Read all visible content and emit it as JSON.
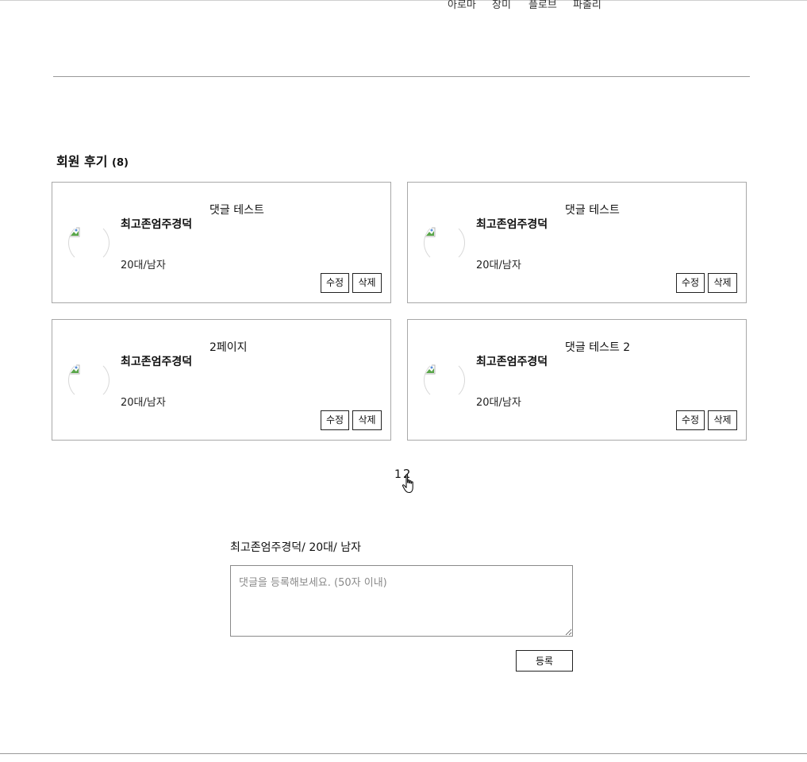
{
  "top_nav": {
    "items": [
      "아로마",
      "장미",
      "플로브",
      "파출리"
    ]
  },
  "reviews": {
    "title": "회원 후기",
    "count": "(8)",
    "cards": [
      {
        "comment": "댓글 테스트",
        "name": "최고존엄주경덕",
        "meta": "20대/남자",
        "edit_label": "수정",
        "delete_label": "삭제"
      },
      {
        "comment": "댓글 테스트",
        "name": "최고존엄주경덕",
        "meta": "20대/남자",
        "edit_label": "수정",
        "delete_label": "삭제"
      },
      {
        "comment": "2페이지",
        "name": "최고존엄주경덕",
        "meta": "20대/남자",
        "edit_label": "수정",
        "delete_label": "삭제"
      },
      {
        "comment": "댓글 테스트 2",
        "name": "최고존엄주경덕",
        "meta": "20대/남자",
        "edit_label": "수정",
        "delete_label": "삭제"
      }
    ]
  },
  "pagination": {
    "pages": [
      "1",
      "2"
    ]
  },
  "comment_form": {
    "user_info": "최고존엄주경덕/ 20대/ 남자",
    "placeholder": "댓글을 등록해보세요. (50자 이내)",
    "submit_label": "등록"
  },
  "colors": {
    "border": "#a8a8a8",
    "text": "#111111",
    "placeholder": "#8a8a8a"
  }
}
